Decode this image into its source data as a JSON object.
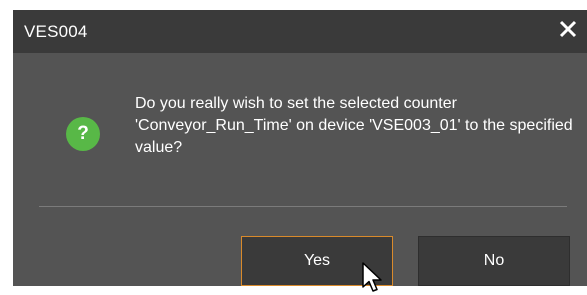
{
  "dialog": {
    "title": "VES004",
    "message": "Do you really wish to set the selected counter 'Conveyor_Run_Time' on device 'VSE003_01' to the specified value?",
    "icon": "question-icon",
    "icon_glyph": "?",
    "buttons": {
      "yes_label": "Yes",
      "no_label": "No"
    }
  },
  "colors": {
    "dialog_bg": "#545454",
    "titlebar_bg": "#3a3a3a",
    "question_icon": "#58b847",
    "focus_border": "#d98a2b"
  }
}
